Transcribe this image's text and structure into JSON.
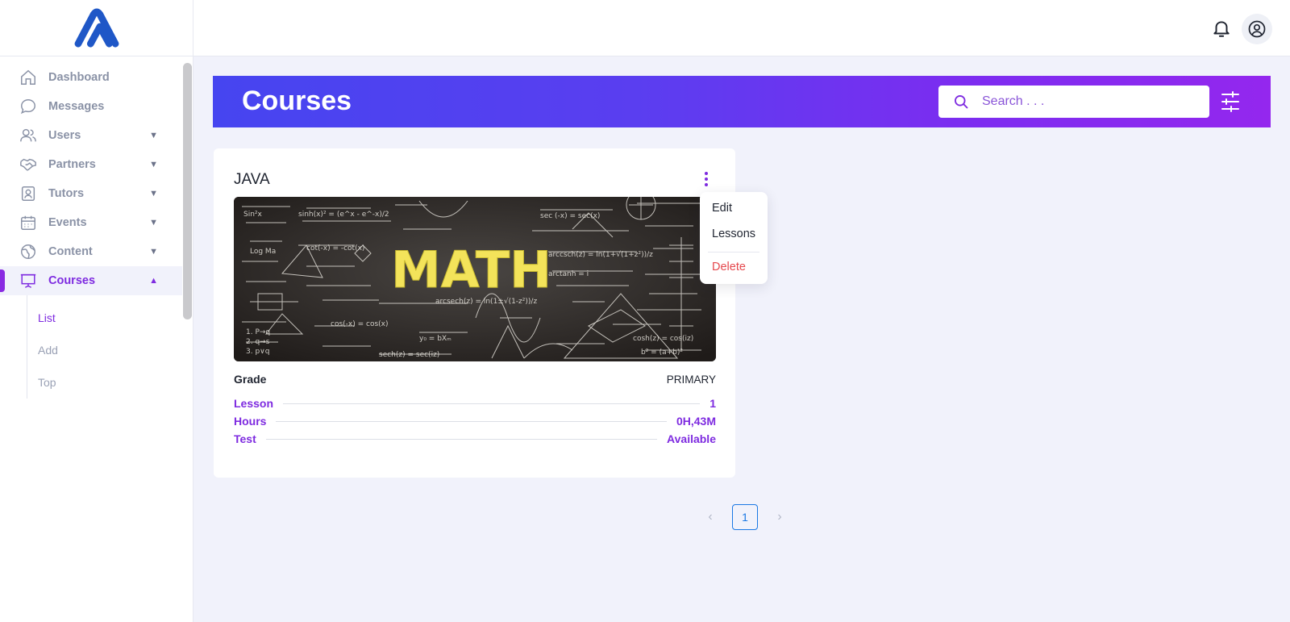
{
  "sidebar": {
    "logo": "app-logo",
    "items": [
      {
        "label": "Dashboard",
        "icon": "home-icon",
        "caret": ""
      },
      {
        "label": "Messages",
        "icon": "chat-bubble-icon",
        "caret": ""
      },
      {
        "label": "Users",
        "icon": "users-icon",
        "caret": "▼"
      },
      {
        "label": "Partners",
        "icon": "handshake-icon",
        "caret": "▼"
      },
      {
        "label": "Tutors",
        "icon": "id-badge-icon",
        "caret": "▼"
      },
      {
        "label": "Events",
        "icon": "calendar-icon",
        "caret": "▼"
      },
      {
        "label": "Content",
        "icon": "globe-icon",
        "caret": "▼"
      },
      {
        "label": "Courses",
        "icon": "presentation-icon",
        "caret": "▲"
      }
    ],
    "courses_sub": [
      {
        "label": "List"
      },
      {
        "label": "Add"
      },
      {
        "label": "Top"
      }
    ]
  },
  "header": {
    "notification_icon": "bell-icon",
    "profile_icon": "user-circle-icon"
  },
  "banner": {
    "title": "Courses",
    "search_placeholder": "Search . . .",
    "filter_icon": "sliders-icon"
  },
  "card": {
    "title": "JAVA",
    "image_text": "MATH",
    "grade_label": "Grade",
    "grade_value": "PRIMARY",
    "lesson_label": "Lesson",
    "lesson_value": "1",
    "hours_label": "Hours",
    "hours_value": "0H,43M",
    "test_label": "Test",
    "test_value": "Available"
  },
  "menu": {
    "edit": "Edit",
    "lessons": "Lessons",
    "delete": "Delete"
  },
  "pagination": {
    "prev": "‹",
    "current": "1",
    "next": "›"
  },
  "colors": {
    "accent": "#7e2be0",
    "banner_start": "#4645f0",
    "banner_end": "#9427ee",
    "danger": "#e5484d",
    "page_bg": "#f1f2fb"
  }
}
